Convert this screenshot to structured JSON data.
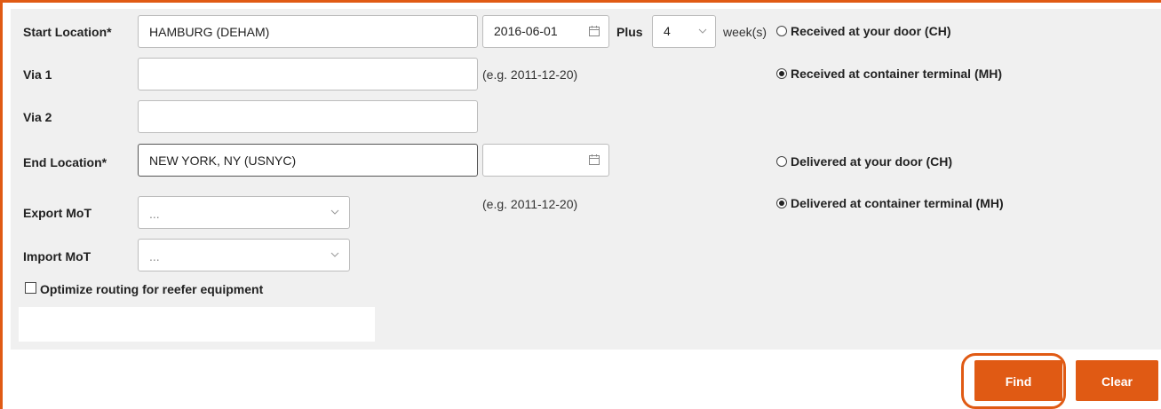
{
  "colors": {
    "accent": "#e05a14",
    "form_bg": "#f0f0f0"
  },
  "start_location": {
    "label": "Start Location*",
    "value": "HAMBURG (DEHAM)",
    "date": "2016-06-01",
    "plus_label": "Plus",
    "plus_value": "4",
    "weeks_label": "week(s)"
  },
  "via1": {
    "label": "Via 1",
    "value": "",
    "date_hint": "(e.g. 2011-12-20)"
  },
  "via2": {
    "label": "Via 2",
    "value": ""
  },
  "end_location": {
    "label": "End Location*",
    "value": "NEW YORK, NY (USNYC)",
    "date": "",
    "date_hint": "(e.g. 2011-12-20)"
  },
  "export_mot": {
    "label": "Export MoT",
    "value": "..."
  },
  "import_mot": {
    "label": "Import MoT",
    "value": "..."
  },
  "reefer": {
    "label": "Optimize routing for reefer equipment",
    "checked": false
  },
  "receipt_options": [
    {
      "label": "Received at your door (CH)",
      "checked": false
    },
    {
      "label": "Received at container terminal (MH)",
      "checked": true
    }
  ],
  "delivery_options": [
    {
      "label": "Delivered at your door (CH)",
      "checked": false
    },
    {
      "label": "Delivered at container terminal (MH)",
      "checked": true
    }
  ],
  "buttons": {
    "find": "Find",
    "clear": "Clear"
  },
  "icons": {
    "calendar": "calendar-icon",
    "chevron": "chevron-down-icon"
  }
}
